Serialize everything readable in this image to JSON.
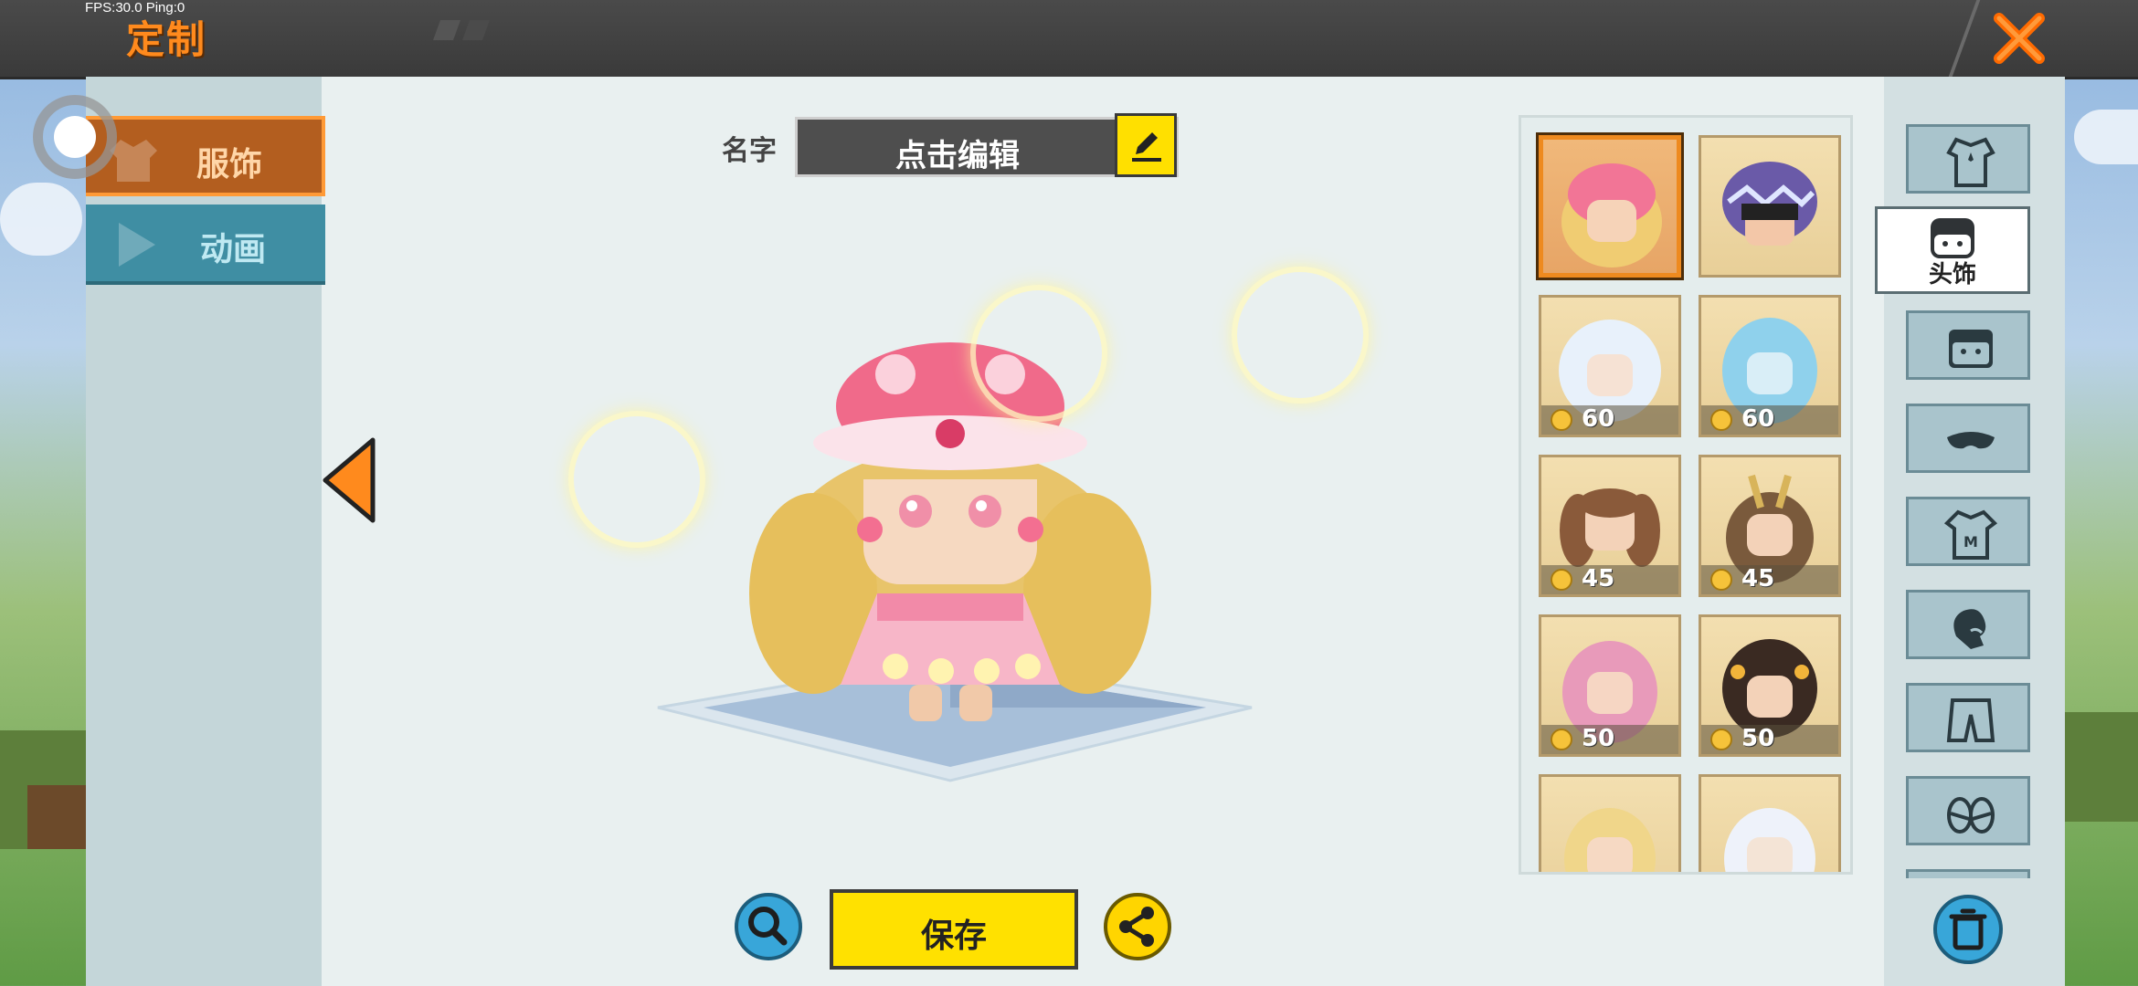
{
  "status": {
    "fps": "FPS:30.0  Ping:0"
  },
  "header": {
    "title": "定制"
  },
  "sidebar": {
    "tabs": [
      {
        "label": "服饰",
        "active": true
      },
      {
        "label": "动画",
        "active": false
      }
    ]
  },
  "name_field": {
    "label": "名字",
    "value": "点击编辑"
  },
  "actions": {
    "save_label": "保存"
  },
  "items": [
    {
      "id": "hat-1",
      "price": "",
      "selected": true
    },
    {
      "id": "hat-2",
      "price": ""
    },
    {
      "id": "hat-3",
      "price": "60"
    },
    {
      "id": "hat-4",
      "price": "60"
    },
    {
      "id": "hat-5",
      "price": "45"
    },
    {
      "id": "hat-6",
      "price": "45"
    },
    {
      "id": "hat-7",
      "price": "50"
    },
    {
      "id": "hat-8",
      "price": "50"
    },
    {
      "id": "hat-9",
      "price": ""
    },
    {
      "id": "hat-10",
      "price": ""
    }
  ],
  "categories": [
    {
      "icon": "suit-icon"
    },
    {
      "icon": "headwear-icon",
      "label": "头饰",
      "active": true
    },
    {
      "icon": "face-icon"
    },
    {
      "icon": "mask-icon"
    },
    {
      "icon": "shirt-icon"
    },
    {
      "icon": "gloves-icon"
    },
    {
      "icon": "pants-icon"
    },
    {
      "icon": "shoes-icon"
    }
  ],
  "colors": {
    "accent": "#ff8a1d",
    "selected_border": "#ee8a1f",
    "button_yellow": "#ffe100",
    "button_blue": "#38a6d9"
  }
}
